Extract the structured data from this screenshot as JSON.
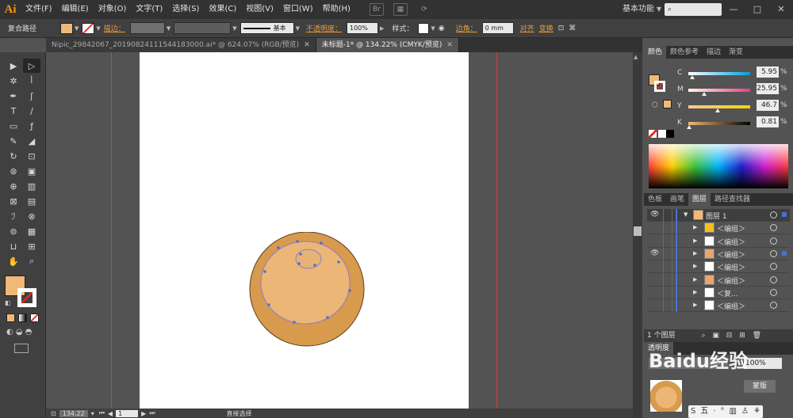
{
  "app": {
    "logo": "Ai",
    "workspace": "基本功能",
    "search_placeholder": "",
    "win_min": "—",
    "win_max": "□",
    "win_close": "✕"
  },
  "menus": [
    "文件(F)",
    "编辑(E)",
    "对象(O)",
    "文字(T)",
    "选择(S)",
    "效果(C)",
    "视图(V)",
    "窗口(W)",
    "帮助(H)"
  ],
  "control": {
    "object_type": "复合路径",
    "stroke_label": "描边：",
    "stroke_style": "基本",
    "opacity_label": "不透明度：",
    "opacity_value": "100%",
    "style_label": "样式：",
    "corner_label": "边角：",
    "corner_value": "0 mm",
    "align_label": "对齐",
    "transform_label": "变换",
    "fill_color": "#F0B978"
  },
  "tabs": [
    {
      "label": "Nipic_29842067_20190824111544183000.ai* @ 624.07% (RGB/预览)",
      "close": "✕",
      "active": false
    },
    {
      "label": "未标题-1* @ 134.22% (CMYK/预览)",
      "close": "✕",
      "active": true
    }
  ],
  "tools": [
    "▶",
    "▷",
    "✲",
    "ᥣ",
    "✒",
    "ʃ",
    "T",
    "∕",
    "▭",
    "ƒ",
    "✎",
    "◢",
    "↻",
    "⊡",
    "⊛",
    "▣",
    "⊕",
    "▥",
    "⊠",
    "▤",
    "ℐ",
    "⊗",
    "⊚",
    "▦",
    "⊔",
    "⊞",
    "✋",
    "⌕"
  ],
  "colors": {
    "fill": "#F0B978",
    "stroke": "#FFFFFF",
    "outer_circle": "#D89A4D",
    "inner_circle": "#ECB776",
    "spot": "#E6B275",
    "anchor": "#4C6FD6",
    "guide": "#C8423F"
  },
  "status": {
    "zoom": "134.22",
    "artboard_num": "1",
    "tool": "直接选择"
  },
  "color_panel": {
    "tabs": [
      "颜色",
      "颜色参考",
      "描边",
      "渐变"
    ],
    "cmyk": [
      {
        "label": "C",
        "value": "5.95",
        "pct": "%",
        "pos": 0.06
      },
      {
        "label": "M",
        "value": "25.95",
        "pct": "%",
        "pos": 0.26
      },
      {
        "label": "Y",
        "value": "46.7",
        "pct": "%",
        "pos": 0.47
      },
      {
        "label": "K",
        "value": "0.81",
        "pct": "%",
        "pos": 0.01
      }
    ]
  },
  "layers_panel": {
    "tabs": [
      "色板",
      "画笔",
      "图层",
      "路径查找器"
    ],
    "rows": [
      {
        "name": "图层 1",
        "eye": "👁",
        "thumb": "#F0B978",
        "depth": 0,
        "sel": true
      },
      {
        "name": "＜编组＞",
        "eye": "",
        "thumb": "#F2C21A",
        "depth": 1,
        "sel": false
      },
      {
        "name": "＜编组＞",
        "eye": "",
        "thumb": "#FFFFFF",
        "depth": 1,
        "sel": false
      },
      {
        "name": "＜编组＞",
        "eye": "👁",
        "thumb": "#E8A76A",
        "depth": 1,
        "sel": true
      },
      {
        "name": "＜编组＞",
        "eye": "",
        "thumb": "#FFFFFF",
        "depth": 1,
        "sel": false
      },
      {
        "name": "＜编组＞",
        "eye": "",
        "thumb": "#E8A76A",
        "depth": 1,
        "sel": false
      },
      {
        "name": "＜复...",
        "eye": "",
        "thumb": "#FFFFFF",
        "depth": 1,
        "sel": false
      },
      {
        "name": "＜编组＞",
        "eye": "",
        "thumb": "#FFFFFF",
        "depth": 1,
        "sel": false
      }
    ],
    "footer": "1 个图层"
  },
  "bottom_panel": {
    "tab": "透明度",
    "value": "100%",
    "mask_button": "蒙版"
  },
  "watermark": "Baidu经验",
  "tray": [
    "S",
    "五",
    "⋅",
    "°",
    "▥",
    "♙",
    "⚘"
  ]
}
